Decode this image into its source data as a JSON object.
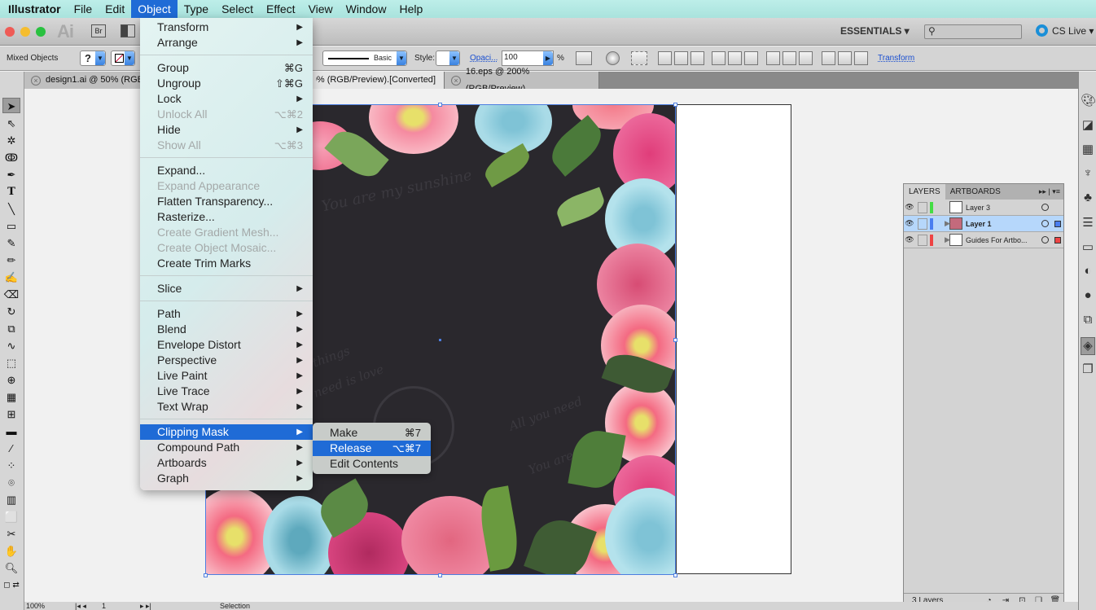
{
  "menubar": {
    "app": "Illustrator",
    "items": [
      "File",
      "Edit",
      "Object",
      "Type",
      "Select",
      "Effect",
      "View",
      "Window",
      "Help"
    ],
    "active": "Object"
  },
  "appbar": {
    "ai_logo": "Ai",
    "bridge": "Br",
    "workspace": "ESSENTIALS ▾",
    "search_placeholder": "",
    "cslive": "CS Live ▾"
  },
  "control": {
    "selection_type": "Mixed Objects",
    "fill": "?",
    "stroke_profile": "Basic",
    "style_label": "Style:",
    "opacity_link": "Opaci...",
    "opacity_value": "100",
    "opacity_unit": "%",
    "transform_link": "Transform"
  },
  "tabs": [
    {
      "label": "design1.ai @ 50% (RGB/Preview)"
    },
    {
      "label": "[Converted].eps* @ 100% (RGB/Preview)"
    },
    {
      "label": "16.eps @ 200% (RGB/Preview)"
    }
  ],
  "object_menu": {
    "groups": [
      [
        {
          "label": "Transform",
          "sub": true
        },
        {
          "label": "Arrange",
          "sub": true
        }
      ],
      [
        {
          "label": "Group",
          "shortcut": "⌘G"
        },
        {
          "label": "Ungroup",
          "shortcut": "⇧⌘G"
        },
        {
          "label": "Lock",
          "sub": true
        },
        {
          "label": "Unlock All",
          "shortcut": "⌥⌘2",
          "disabled": true
        },
        {
          "label": "Hide",
          "sub": true
        },
        {
          "label": "Show All",
          "shortcut": "⌥⌘3",
          "disabled": true
        }
      ],
      [
        {
          "label": "Expand..."
        },
        {
          "label": "Expand Appearance",
          "disabled": true
        },
        {
          "label": "Flatten Transparency..."
        },
        {
          "label": "Rasterize..."
        },
        {
          "label": "Create Gradient Mesh...",
          "disabled": true
        },
        {
          "label": "Create Object Mosaic...",
          "disabled": true
        },
        {
          "label": "Create Trim Marks"
        }
      ],
      [
        {
          "label": "Slice",
          "sub": true
        }
      ],
      [
        {
          "label": "Path",
          "sub": true
        },
        {
          "label": "Blend",
          "sub": true
        },
        {
          "label": "Envelope Distort",
          "sub": true
        },
        {
          "label": "Perspective",
          "sub": true
        },
        {
          "label": "Live Paint",
          "sub": true
        },
        {
          "label": "Live Trace",
          "sub": true
        },
        {
          "label": "Text Wrap",
          "sub": true
        }
      ],
      [
        {
          "label": "Clipping Mask",
          "sub": true,
          "highlighted": true
        },
        {
          "label": "Compound Path",
          "sub": true
        },
        {
          "label": "Artboards",
          "sub": true
        },
        {
          "label": "Graph",
          "sub": true
        }
      ]
    ]
  },
  "clipping_submenu": [
    {
      "label": "Make",
      "shortcut": "⌘7"
    },
    {
      "label": "Release",
      "shortcut": "⌥⌘7",
      "highlighted": true
    },
    {
      "label": "Edit Contents"
    }
  ],
  "artwork": {
    "script_texts": [
      "You are my sunshine",
      "things",
      "need is love",
      "All you need",
      "You are",
      "All we need is love"
    ]
  },
  "layers_panel": {
    "tabs": [
      "LAYERS",
      "ARTBOARDS"
    ],
    "layers": [
      {
        "name": "Layer 3",
        "color": "#44dd44",
        "selected": false,
        "expandable": false
      },
      {
        "name": "Layer 1",
        "color": "#4a7ef0",
        "selected": true,
        "expandable": true
      },
      {
        "name": "Guides For Artbo...",
        "color": "#ee4444",
        "selected": false,
        "expandable": true
      }
    ],
    "count": "3 Layers"
  },
  "status": {
    "zoom": "100%",
    "artboard": "1",
    "tool": "Selection"
  },
  "colors": {
    "menu_highlight": "#1f6bd6",
    "menubar_bg": "#b4e9e4",
    "artwork_bg": "#2a282d",
    "selection": "#4d7ee0"
  }
}
